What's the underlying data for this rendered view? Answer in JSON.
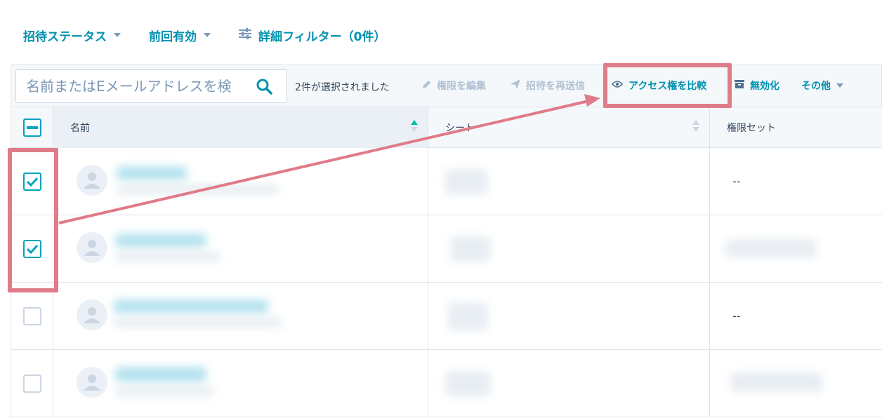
{
  "filters": {
    "invite_status": "招待ステータス",
    "last_active": "前回有効",
    "advanced_filters": "詳細フィルター（0件）"
  },
  "toolbar": {
    "search_placeholder": "名前またはEメールアドレスを検",
    "selected_count": "2件が選択されました",
    "edit_permissions": "権限を編集",
    "resend_invite": "招待を再送信",
    "compare_access": "アクセス権を比較",
    "deactivate": "無効化",
    "more": "その他"
  },
  "table": {
    "columns": [
      "名前",
      "シート",
      "権限セット"
    ],
    "rows": [
      {
        "checked": true,
        "permission_set": "--"
      },
      {
        "checked": true,
        "permission_set": ""
      },
      {
        "checked": false,
        "permission_set": "--"
      },
      {
        "checked": false,
        "permission_set": ""
      }
    ]
  },
  "colors": {
    "accent": "#0091ae",
    "checkbox": "#00a4bd",
    "annotation": "#e07b89"
  }
}
